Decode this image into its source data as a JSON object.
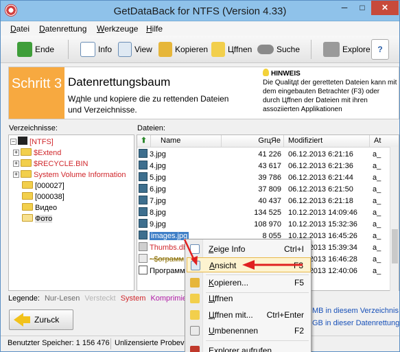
{
  "window": {
    "title": "GetDataBack for NTFS (Version 4.33)",
    "min": "─",
    "max": "□",
    "close": "✕"
  },
  "menu": [
    "Datei",
    "Datenrettung",
    "Werkzeuge",
    "Hilfe"
  ],
  "toolbar": {
    "ende": "Ende",
    "info": "Info",
    "view": "View",
    "kopieren": "Kopieren",
    "oeffnen": "Цffnen",
    "suche": "Suche",
    "explore": "Explore",
    "help": "?"
  },
  "header": {
    "step": "Schritt 3",
    "title": "Datenrettungsbaum",
    "subtitle": "Wдhle und kopiere die zu rettenden Dateien und Verzeichnisse.",
    "hint_title": "HINWEIS",
    "hint_text": "Die Qualitдt der geretteten Dateien kann mit dem eingebauten Betrachter (F3) oder durch Цffnen der Dateien mit ihren assoziierten Applikationen"
  },
  "tree": {
    "label": "Verzeichnisse:",
    "items": [
      "[NTFS]",
      "$Extend",
      "$RECYCLE.BIN",
      "System Volume Information",
      "[000027]",
      "[000038]",
      "Видео",
      "Фото"
    ]
  },
  "files": {
    "label": "Dateien:",
    "columns": [
      "Name",
      "GrцЯe",
      "Modifiziert",
      "At"
    ],
    "rows": [
      {
        "name": "3.jpg",
        "size": "41 226",
        "mod": "06.12.2013 6:21:16",
        "attr": "a_"
      },
      {
        "name": "4.jpg",
        "size": "43 617",
        "mod": "06.12.2013 6:21:36",
        "attr": "a_"
      },
      {
        "name": "5.jpg",
        "size": "39 786",
        "mod": "06.12.2013 6:21:44",
        "attr": "a_"
      },
      {
        "name": "6.jpg",
        "size": "37 809",
        "mod": "06.12.2013 6:21:50",
        "attr": "a_"
      },
      {
        "name": "7.jpg",
        "size": "40 437",
        "mod": "06.12.2013 6:21:18",
        "attr": "a_"
      },
      {
        "name": "8.jpg",
        "size": "134 525",
        "mod": "10.12.2013 14:09:46",
        "attr": "a_"
      },
      {
        "name": "9.jpg",
        "size": "108 970",
        "mod": "10.12.2013 15:32:36",
        "attr": "a_"
      },
      {
        "name": "images.jpg",
        "size": "8 055",
        "mod": "10.12.2013 16:45:26",
        "attr": "a_"
      },
      {
        "name": "Thumbs.db",
        "size": "",
        "mod": "10.12.2013 15:39:34",
        "attr": "a_"
      },
      {
        "name": "~$ограмм",
        "size": "",
        "mod": "10.12.2013 16:46:28",
        "attr": "a_"
      },
      {
        "name": "Программ",
        "size": "",
        "mod": "10.12.2013 12:40:06",
        "attr": "a_"
      }
    ]
  },
  "legend": {
    "label": "Legende:",
    "items": [
      {
        "text": "Nur-Lesen",
        "color": "#6b6b6b"
      },
      {
        "text": "Versteckt",
        "color": "#b5b5b5"
      },
      {
        "text": "System",
        "color": "#d0262b"
      },
      {
        "text": "Komprimiert",
        "color": "#b01aa6"
      }
    ]
  },
  "info_right": {
    "line1": "MB in diesem Verzeichnis",
    "line2": "GB in dieser Datenrettung"
  },
  "back_button": "Zurьck",
  "status": {
    "memory": "Benutzter Speicher: 1 156 476",
    "license": "Unlizensierte Probever"
  },
  "context_menu": [
    {
      "label": "Zeige Info",
      "shortcut": "Ctrl+I"
    },
    {
      "label": "Ansicht",
      "shortcut": "F3"
    },
    {
      "label": "Kopieren...",
      "shortcut": "F5"
    },
    {
      "label": "Цffnen",
      "shortcut": ""
    },
    {
      "label": "Цffnen mit...",
      "shortcut": "Ctrl+Enter"
    },
    {
      "label": "Umbenennen",
      "shortcut": "F2"
    },
    {
      "label": "Explorer aufrufen...",
      "shortcut": ""
    }
  ],
  "colors": {
    "step_bg": "#f7a940",
    "selection": "#3e7fc7",
    "menu_highlight": "#fdf3d0",
    "annotation_arrow": "#e02020"
  }
}
